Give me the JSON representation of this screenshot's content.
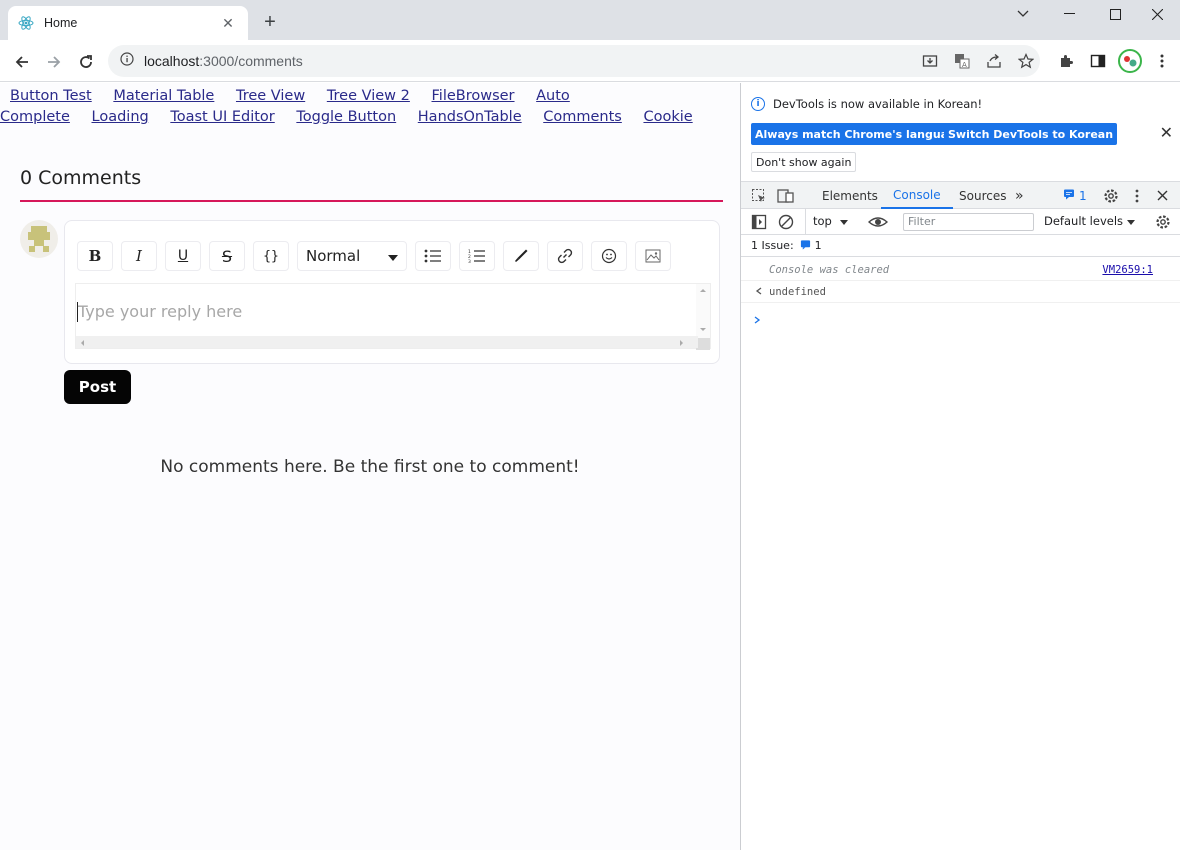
{
  "browser": {
    "tab_title": "Home",
    "url_host": "localhost",
    "url_path": ":3000/comments"
  },
  "nav_links_row1": [
    "Button Test",
    "Material Table",
    "Tree View",
    "Tree View 2",
    "FileBrowser",
    "Auto"
  ],
  "nav_links_row2": [
    "Complete",
    "Loading",
    "Toast UI Editor",
    "Toggle Button",
    "HandsOnTable",
    "Comments",
    "Cookie"
  ],
  "comments": {
    "heading": "0 Comments",
    "editor_toolbar": {
      "bold": "B",
      "italic": "I",
      "underline": "U",
      "strike": "S",
      "code": "{}",
      "format_select": "Normal"
    },
    "placeholder": "Type your reply here",
    "post_label": "Post",
    "empty_message": "No comments here. Be the first one to comment!"
  },
  "devtools": {
    "info_message": "DevTools is now available in Korean!",
    "btn_match_language": "Always match Chrome's language",
    "btn_switch_korean": "Switch DevTools to Korean",
    "btn_dont_show": "Don't show again",
    "tabs": [
      "Elements",
      "Console",
      "Sources"
    ],
    "active_tab": "Console",
    "issue_count": "1",
    "context": "top",
    "filter_placeholder": "Filter",
    "levels": "Default levels",
    "issue_bar_label": "1 Issue:",
    "issue_bar_count": "1",
    "console_lines": [
      {
        "text": "Console was cleared",
        "source": "VM2659:1"
      },
      {
        "text": "undefined",
        "source": ""
      }
    ]
  },
  "colors": {
    "accent_red": "#d6175a",
    "chrome_blue": "#1a73e8",
    "post_button": "#050505"
  }
}
